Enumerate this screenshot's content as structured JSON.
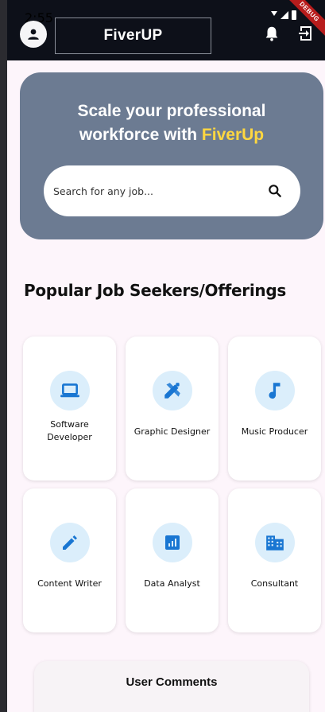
{
  "status_bar": {
    "time": "2:55"
  },
  "app_bar": {
    "title": "FiverUP",
    "debug_label": "DEBUG"
  },
  "hero": {
    "title_line1": "Scale your professional",
    "title_line2_prefix": "workforce with ",
    "title_line2_accent": "FiverUp",
    "search_placeholder": "Search for any job..."
  },
  "section": {
    "title": "Popular Job Seekers/Offerings"
  },
  "categories": [
    {
      "label_line1": "Software",
      "label_line2": "Developer",
      "icon": "laptop-icon"
    },
    {
      "label_line1": "Graphic Designer",
      "icon": "design-tools-icon"
    },
    {
      "label_line1": "Music Producer",
      "icon": "music-note-icon"
    },
    {
      "label_line1": "Content Writer",
      "icon": "pencil-icon"
    },
    {
      "label_line1": "Data Analyst",
      "icon": "bar-chart-icon"
    },
    {
      "label_line1": "Consultant",
      "icon": "business-building-icon"
    }
  ],
  "comments": {
    "title": "User Comments"
  },
  "colors": {
    "accent": "#ffd740",
    "hero_bg": "#6c7b92",
    "icon_blue": "#1976d2",
    "icon_bg": "#dbeefb",
    "appbar_bg": "#0d1019"
  }
}
